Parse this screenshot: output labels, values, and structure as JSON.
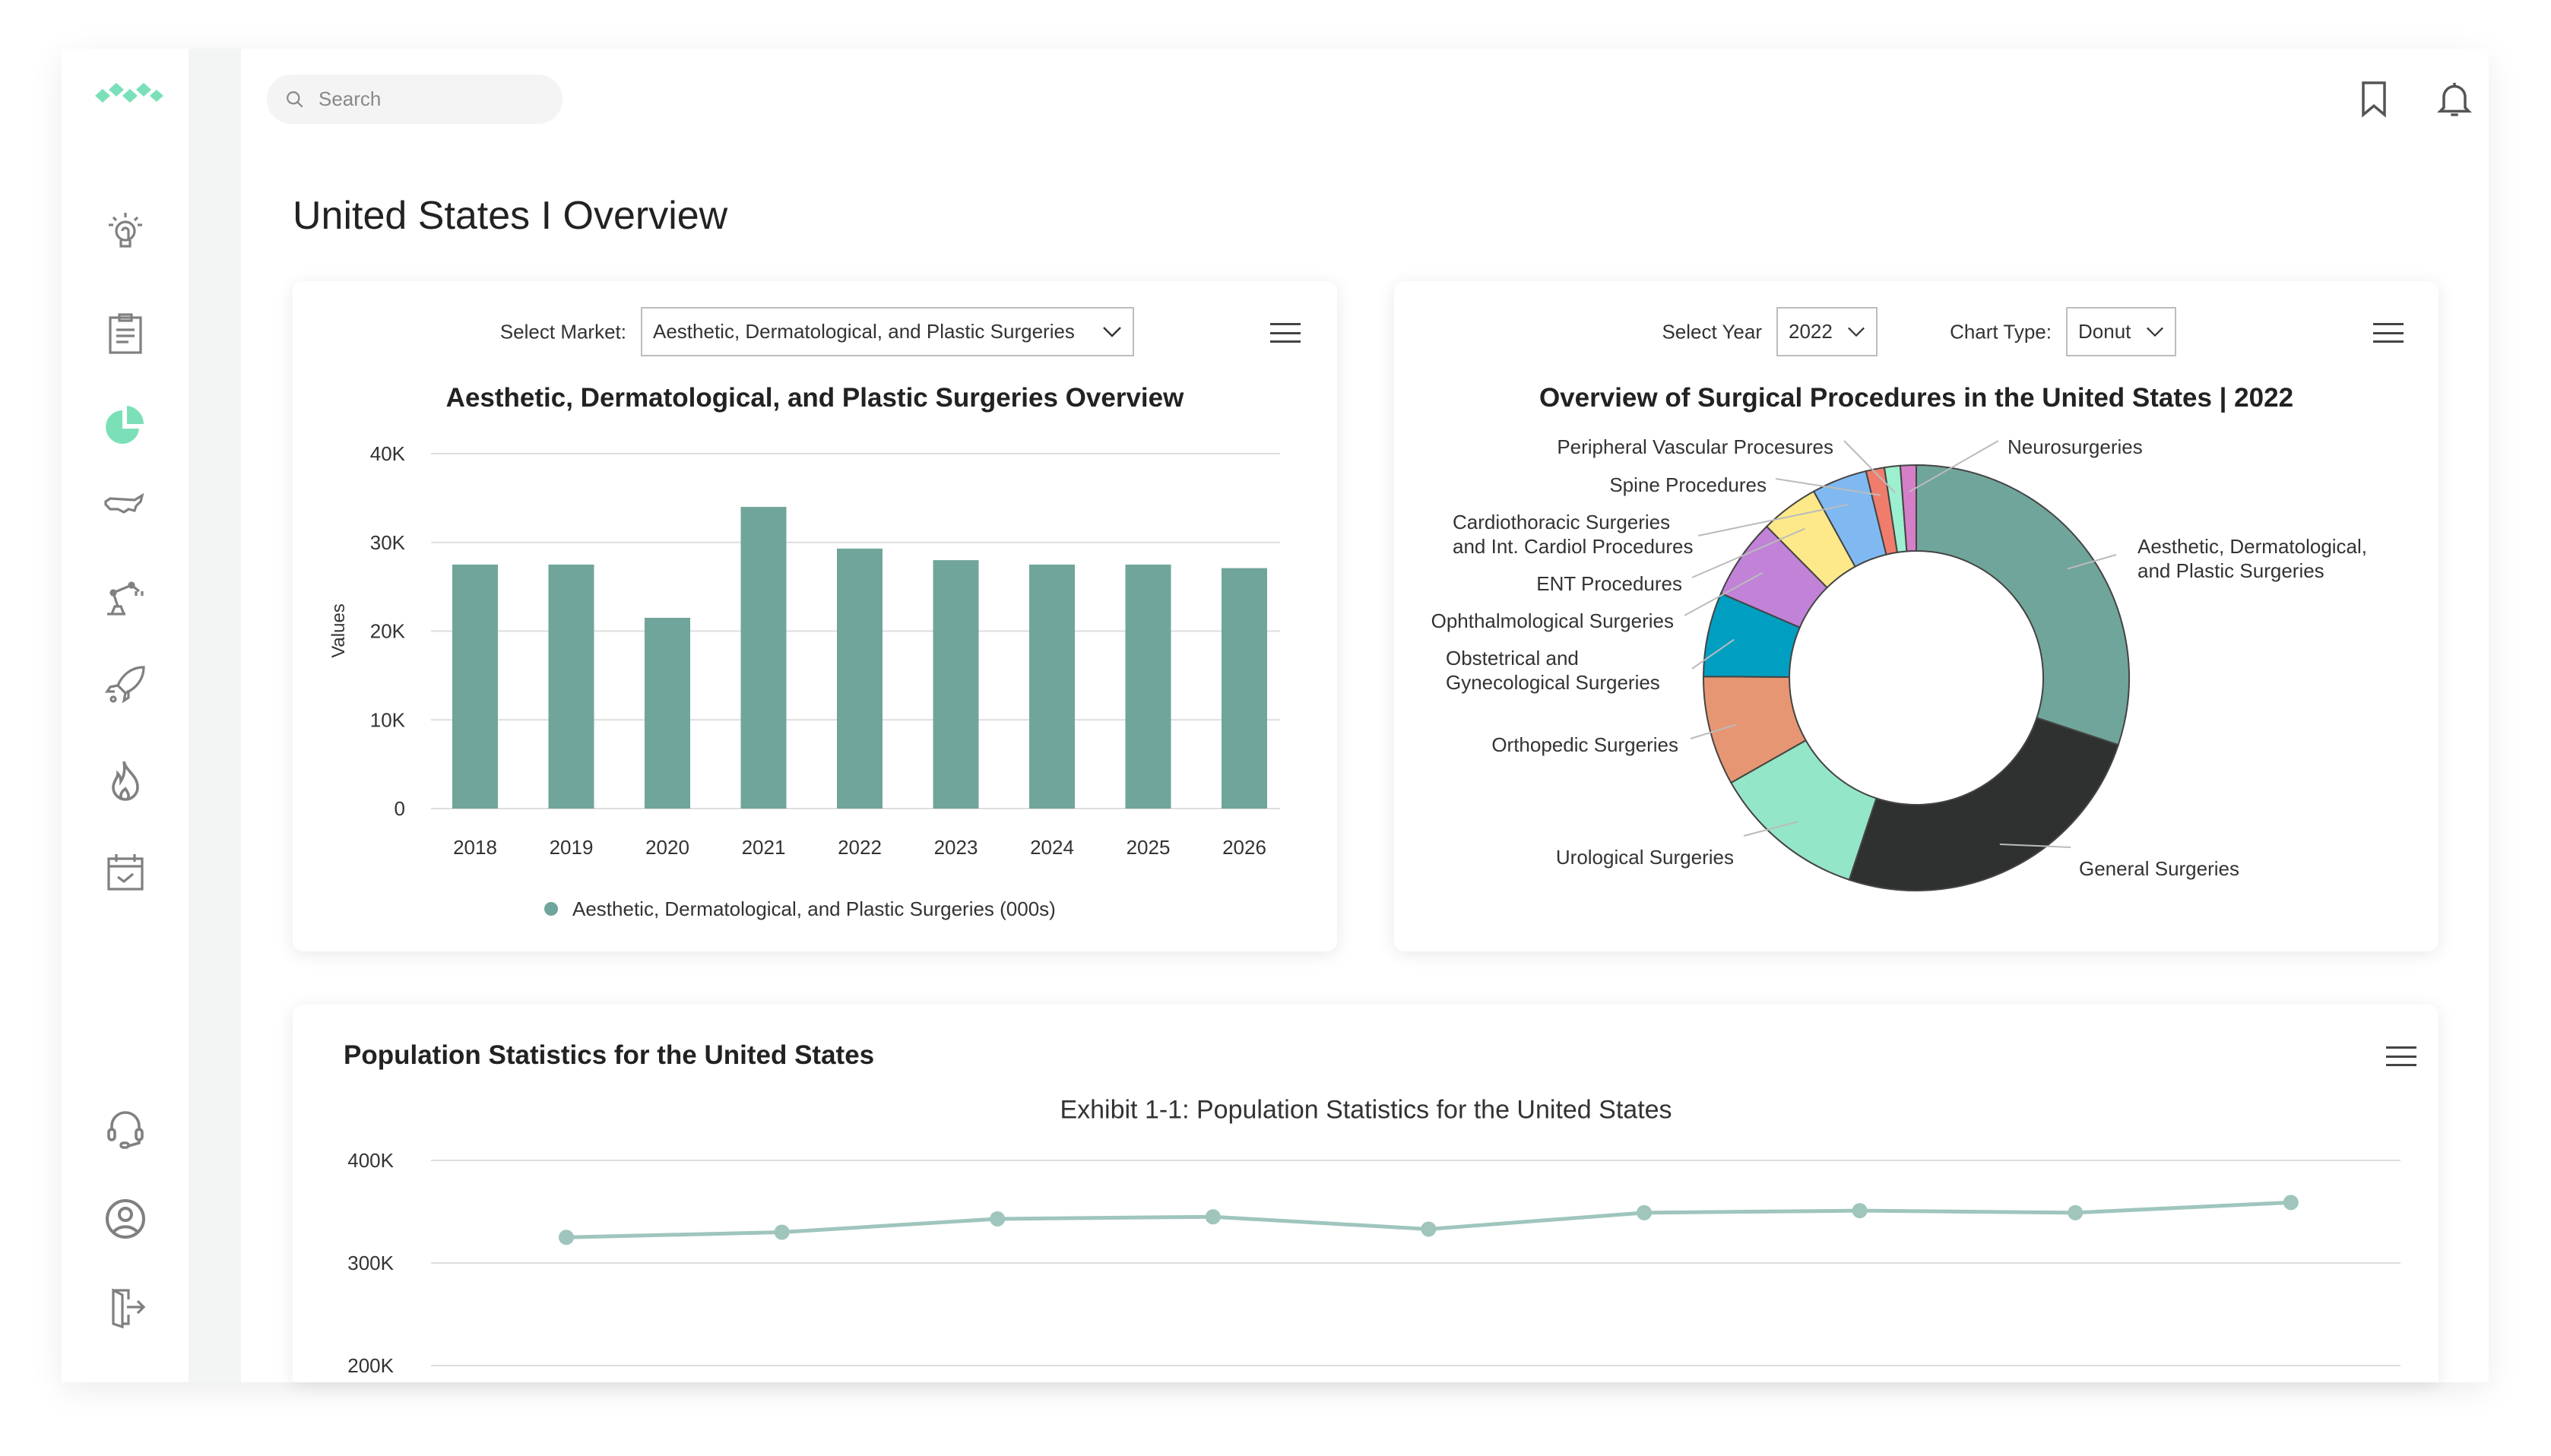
{
  "search": {
    "placeholder": "Search"
  },
  "page": {
    "title": "United States I Overview"
  },
  "sidebar": {
    "items": [
      {
        "name": "insights",
        "icon": "lightbulb-icon"
      },
      {
        "name": "reports",
        "icon": "clipboard-icon"
      },
      {
        "name": "market-overview",
        "icon": "pie-chart-icon",
        "active": true
      },
      {
        "name": "country",
        "icon": "us-map-icon"
      },
      {
        "name": "industry",
        "icon": "robot-arm-icon"
      },
      {
        "name": "launch",
        "icon": "rocket-icon"
      },
      {
        "name": "trending",
        "icon": "flame-icon"
      },
      {
        "name": "events",
        "icon": "calendar-check-icon"
      }
    ],
    "bottom": [
      {
        "name": "support",
        "icon": "headset-icon"
      },
      {
        "name": "profile",
        "icon": "user-circle-icon"
      },
      {
        "name": "logout",
        "icon": "logout-icon"
      }
    ]
  },
  "colors": {
    "accent": "#7be0b8",
    "bar": "#70a59b",
    "line": "#9fc5bd",
    "icon": "#808080"
  },
  "market_card": {
    "select_label": "Select Market:",
    "selected": "Aesthetic, Dermatological, and Plastic Surgeries"
  },
  "procedures_card": {
    "year_label": "Select Year",
    "year": "2022",
    "type_label": "Chart Type:",
    "type": "Donut"
  },
  "population_card": {
    "heading": "Population Statistics for the United States"
  },
  "chart_data": [
    {
      "type": "bar",
      "title": "Aesthetic, Dermatological, and Plastic Surgeries Overview",
      "xlabel": "",
      "ylabel": "Values",
      "categories": [
        "2018",
        "2019",
        "2020",
        "2021",
        "2022",
        "2023",
        "2024",
        "2025",
        "2026"
      ],
      "series": [
        {
          "name": "Aesthetic, Dermatological, and Plastic Surgeries (000s)",
          "values": [
            27500,
            27500,
            21500,
            34000,
            29300,
            28000,
            27500,
            27500,
            27100
          ]
        }
      ],
      "ylim": [
        0,
        40000
      ],
      "yticks": [
        "0",
        "10K",
        "20K",
        "30K",
        "40K"
      ],
      "grid": true,
      "legend": "bottom"
    },
    {
      "type": "pie",
      "variant": "donut",
      "title": "Overview of Surgical Procedures in the United States | 2022",
      "slices": [
        {
          "label": "Aesthetic, Dermatological, and Plastic Surgeries",
          "value": 30.1,
          "color": "#70a59b"
        },
        {
          "label": "General Surgeries",
          "value": 25,
          "color": "#2f3130"
        },
        {
          "label": "Urological Surgeries",
          "value": 11.7,
          "color": "#93e6c7"
        },
        {
          "label": "Orthopedic Surgeries",
          "value": 8.3,
          "color": "#e69673"
        },
        {
          "label": "Obstetrical and Gynecological Surgeries",
          "value": 6.4,
          "color": "#009fc1"
        },
        {
          "label": "Ophthalmological Surgeries",
          "value": 6.1,
          "color": "#c182d8"
        },
        {
          "label": "ENT Procedures",
          "value": 4.4,
          "color": "#fde989"
        },
        {
          "label": "Cardiothoracic Surgeries and Int. Cardiol Procedures",
          "value": 4.2,
          "color": "#80b9f1"
        },
        {
          "label": "Spine Procedures",
          "value": 1.4,
          "color": "#f07d6c"
        },
        {
          "label": "Peripheral Vascular Procesures",
          "value": 1.2,
          "color": "#9cf0cf"
        },
        {
          "label": "Neurosurgeries",
          "value": 1.2,
          "color": "#d47fc7"
        }
      ],
      "legend": "none"
    },
    {
      "type": "line",
      "title": "Exhibit 1-1: Population Statistics for the United States",
      "values": [
        325000,
        330000,
        343000,
        345000,
        333000,
        349000,
        351000,
        349000,
        359000
      ],
      "yticks": [
        "200K",
        "300K",
        "400K"
      ],
      "ylim_visible": [
        200000,
        400000
      ],
      "grid": true
    }
  ]
}
